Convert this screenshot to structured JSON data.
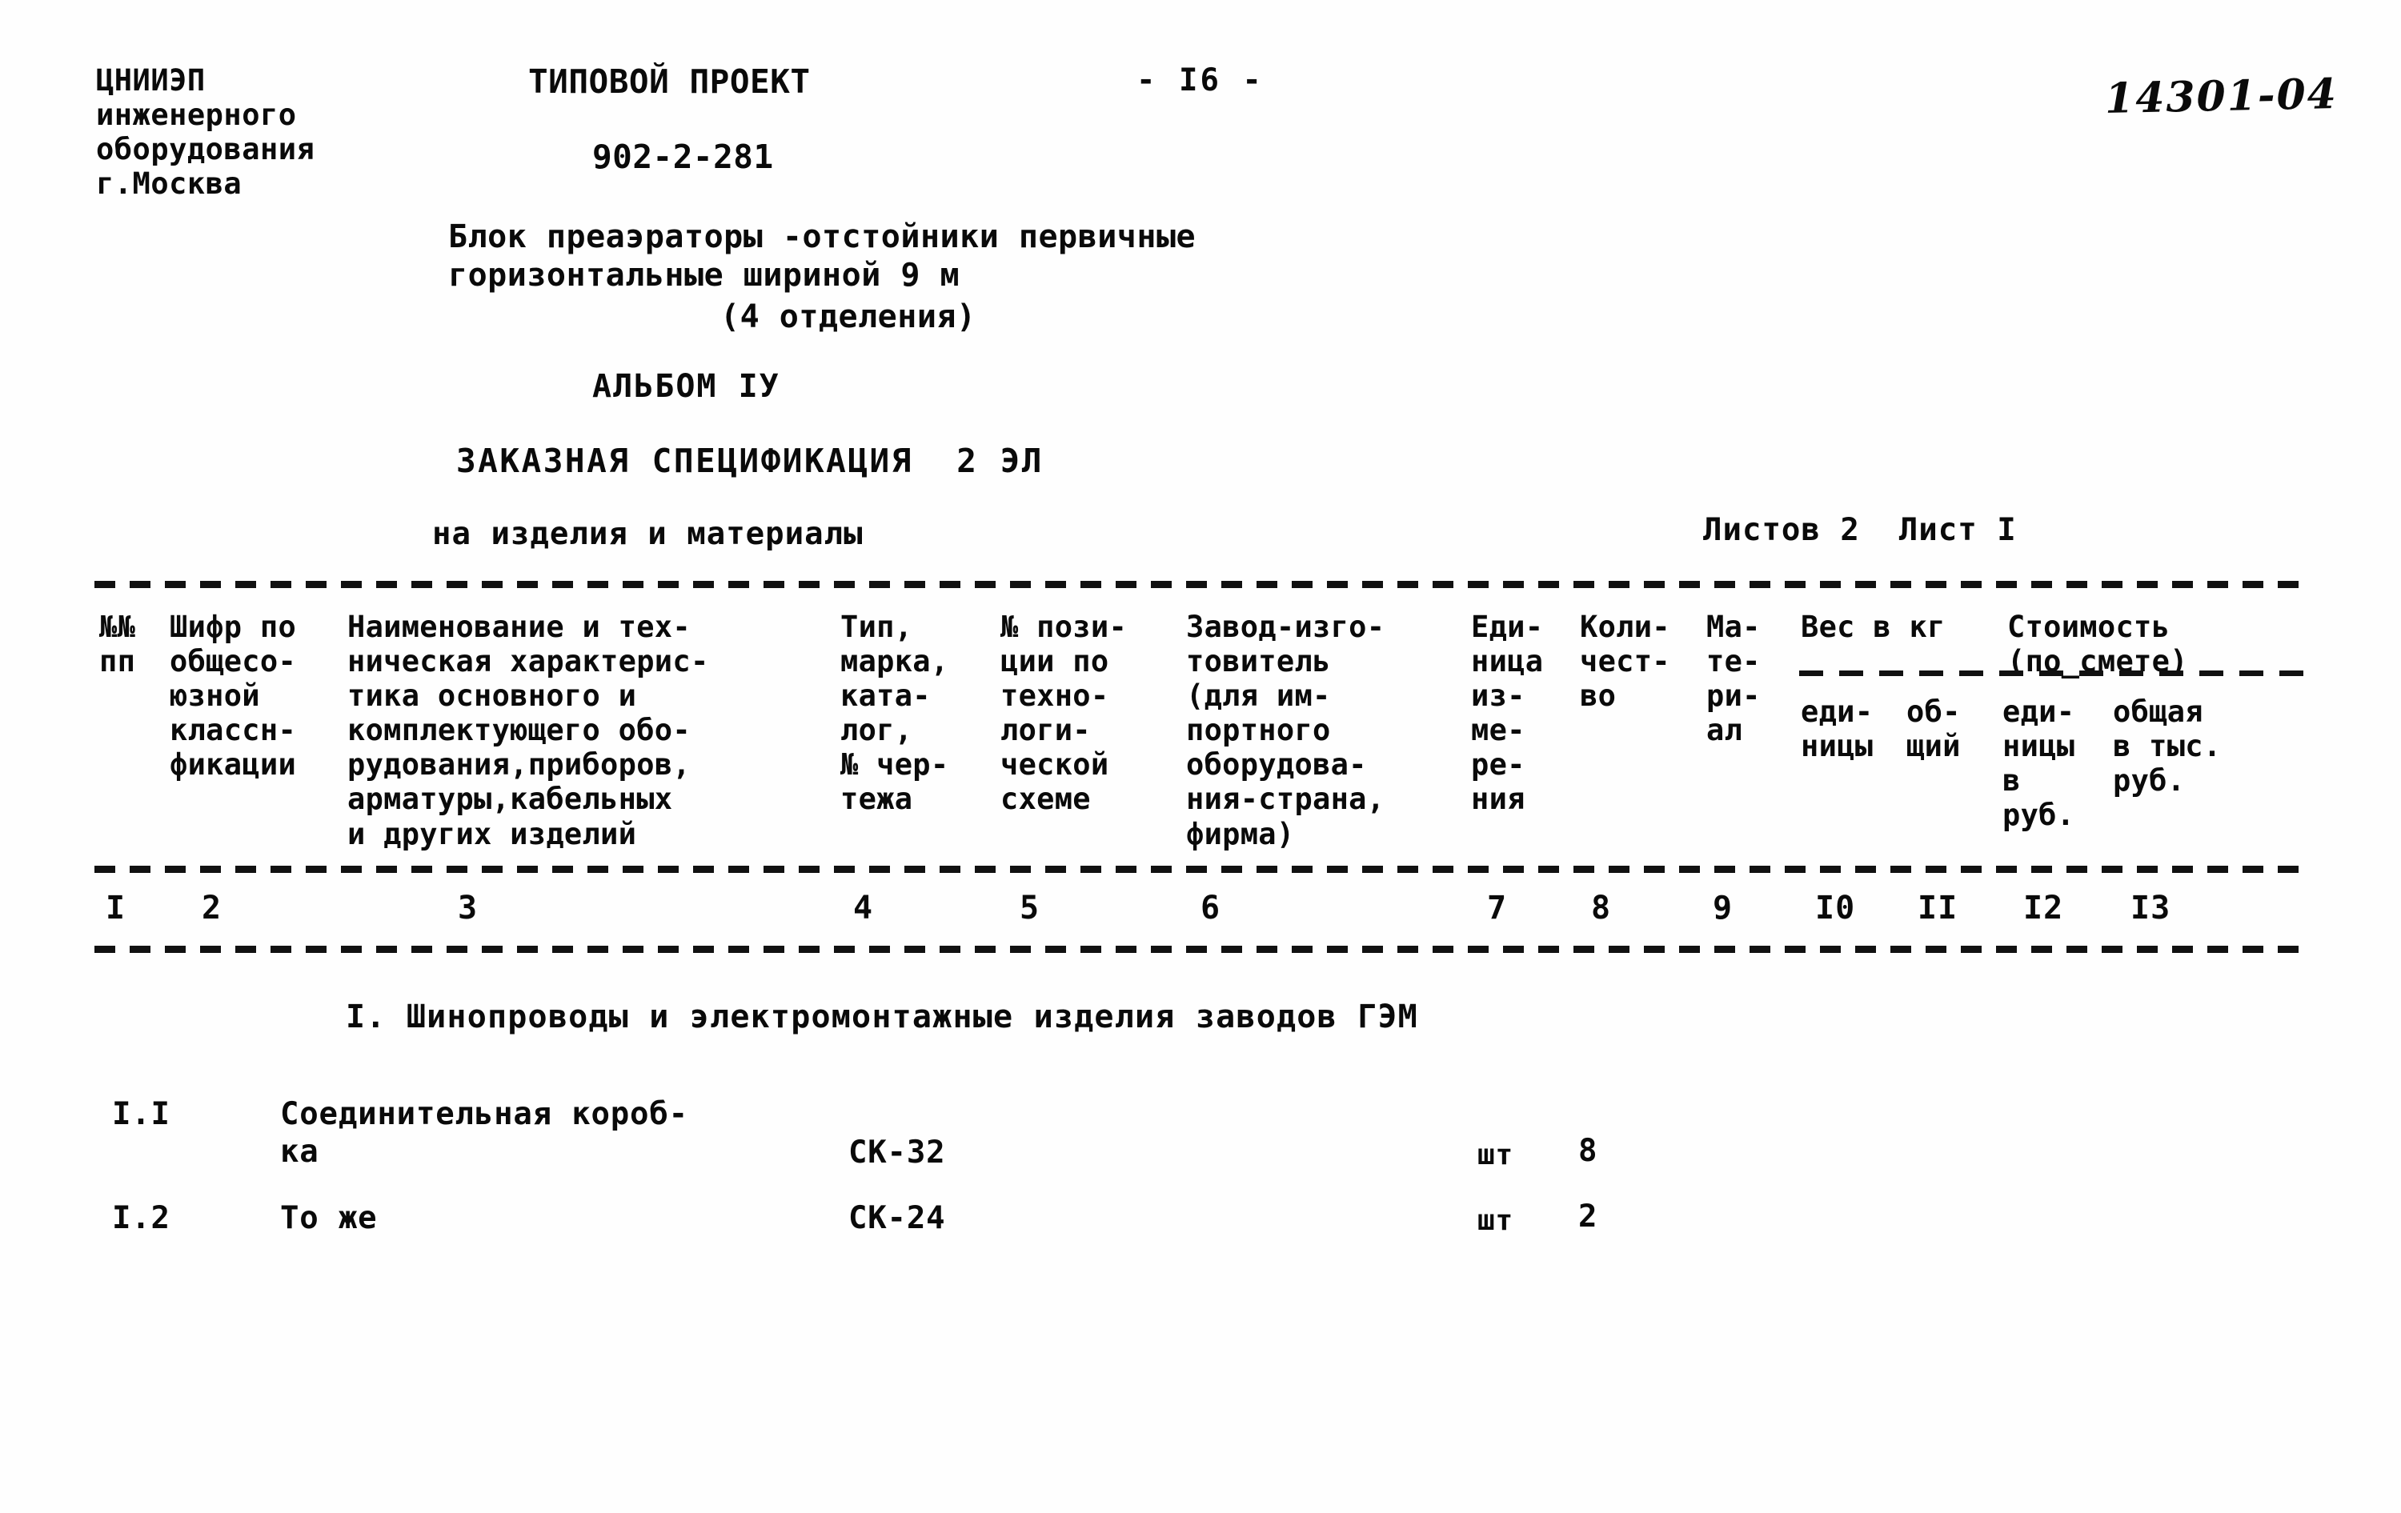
{
  "document": {
    "organization": "ЦНИИЭП\nинженерного\nоборудования\nг.Москва",
    "project_type": "ТИПОВОЙ ПРОЕКТ",
    "project_code": "902-2-281",
    "page_marker": "- I6 -",
    "archive_code": "14301-04",
    "object_title": "Блок преаэраторы -отстойники первичные\nгоризонтальные шириной 9 м",
    "object_subtitle": "(4 отделения)",
    "album": "АЛЬБОМ IУ",
    "specification_title": "ЗАКАЗНАЯ СПЕЦИФИКАЦИЯ  2 ЭЛ",
    "specification_subtitle": "на изделия и материалы",
    "sheets_info": "Листов 2  Лист I"
  },
  "table": {
    "headers": {
      "col1": "№№\nпп",
      "col2": "Шифр по\nобщесо-\nюзной\nклассн-\nфикации",
      "col3": "Наименование и тех-\nническая характерис-\nтика основного и\nкомплектующего обо-\nрудования,приборов,\nарматуры,кабельных\nи других изделий",
      "col4": "Тип,\nмарка,\nката-\nлог,\n№ чер-\nтежа",
      "col5": "№ пози-\nции по\nтехно-\nлоги-\nческой\nсхеме",
      "col6": "Завод-изго-\nтовитель\n(для им-\nпортного\nоборудова-\nния-страна,\nфирма)",
      "col7": "Еди-\nница\nиз-\nме-\nре-\nния",
      "col8": "Коли-\nчест-\nво",
      "col9": "Ма-\nте-\nри-\nал",
      "group_weight": "Вес в кг",
      "group_cost": "Стоимость\n(по_смете)",
      "col10": "еди-\nницы",
      "col11": "об-\nщий",
      "col12": "еди-\nницы\nв\nруб.",
      "col13": "общая\nв тыс.\nруб."
    },
    "column_numbers": {
      "n1": "I",
      "n2": "2",
      "n3": "3",
      "n4": "4",
      "n5": "5",
      "n6": "6",
      "n7": "7",
      "n8": "8",
      "n9": "9",
      "n10": "I0",
      "n11": "II",
      "n12": "I2",
      "n13": "I3"
    },
    "section_heading": "I. Шинопроводы и электромонтажные изделия заводов ГЭМ",
    "rows": [
      {
        "num": "I.I",
        "name": "Соединительная короб-\nка",
        "type": "СК-32",
        "unit": "шт",
        "qty": "8"
      },
      {
        "num": "I.2",
        "name": "То же",
        "type": "СК-24",
        "unit": "шт",
        "qty": "2"
      }
    ]
  }
}
